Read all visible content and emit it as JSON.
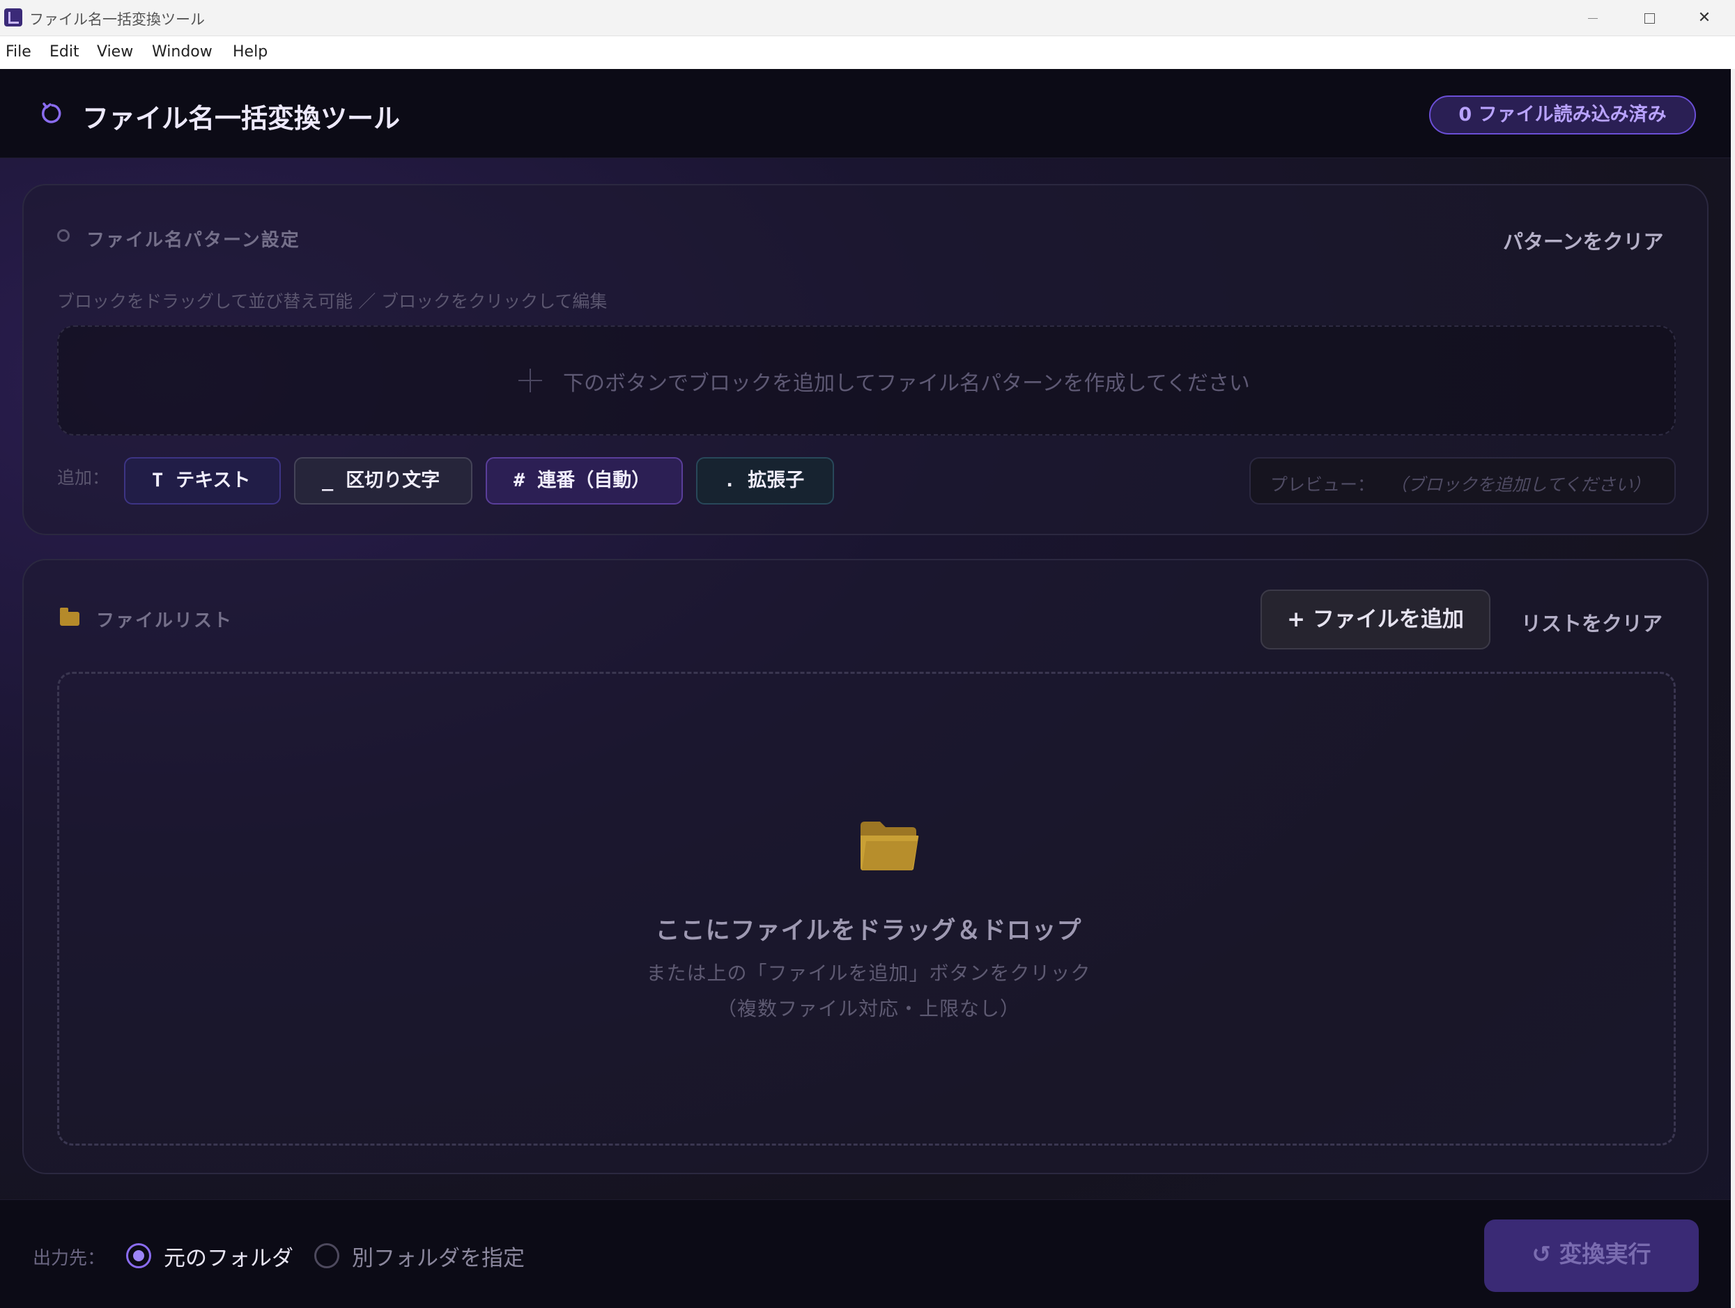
{
  "window": {
    "title": "ファイル名一括変換ツール",
    "controls": {
      "minimize": "—",
      "maximize": "☐",
      "close": "✕"
    }
  },
  "menubar": {
    "items": [
      "File",
      "Edit",
      "View",
      "Window",
      "Help"
    ]
  },
  "header": {
    "title": "ファイル名一括変換ツール",
    "file_count_badge": "0 ファイル読み込み済み"
  },
  "pattern_section": {
    "title": "ファイル名パターン設定",
    "clear_label": "パターンをクリア",
    "hint": "ブロックをドラッグして並び替え可能 ／ ブロックをクリックして編集",
    "empty_message": "下のボタンでブロックを追加してファイル名パターンを作成してください",
    "add_label": "追加：",
    "block_buttons": [
      {
        "symbol": "T",
        "label": "テキスト"
      },
      {
        "symbol": "_",
        "label": "区切り文字"
      },
      {
        "symbol": "#",
        "label": "連番（自動）"
      },
      {
        "symbol": ".",
        "label": "拡張子"
      }
    ],
    "preview_label": "プレビュー：",
    "preview_value": "（ブロックを追加してください）"
  },
  "file_section": {
    "title": "ファイルリスト",
    "add_files_label": "+ ファイルを追加",
    "clear_list_label": "リストをクリア",
    "drop_title": "ここにファイルをドラッグ＆ドロップ",
    "drop_subtitle1": "または上の「ファイルを追加」ボタンをクリック",
    "drop_subtitle2": "（複数ファイル対応・上限なし）"
  },
  "footer": {
    "output_label": "出力先：",
    "options": [
      {
        "label": "元のフォルダ",
        "selected": true
      },
      {
        "label": "別フォルダを指定",
        "selected": false
      }
    ],
    "convert_label": "↺ 変換実行"
  },
  "colors": {
    "accent": "#8a6cf0",
    "background": "#0c0b16",
    "folder": "#b58a2a"
  }
}
